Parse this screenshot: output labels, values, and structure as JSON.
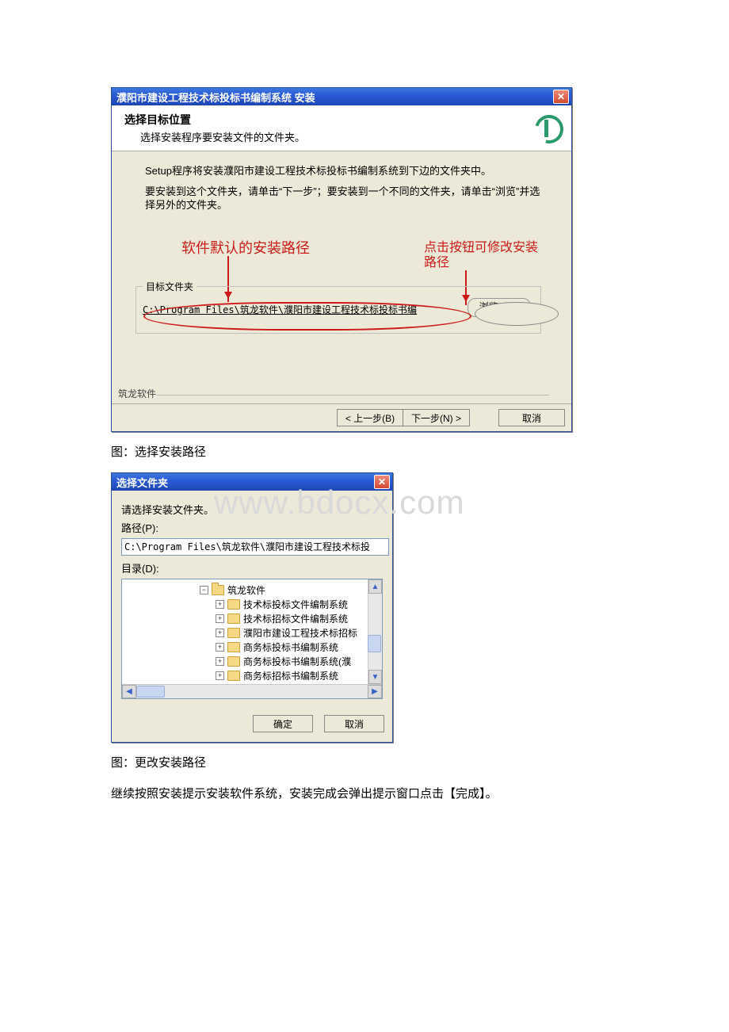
{
  "watermark": "www.bdocx.com",
  "win1": {
    "title": "濮阳市建设工程技术标投标书编制系统 安装",
    "header_bold": "选择目标位置",
    "header_sub": "选择安装程序要安装文件的文件夹。",
    "p1": "Setup程序将安装濮阳市建设工程技术标投标书编制系统到下边的文件夹中。",
    "p2": "要安装到这个文件夹，请单击“下一步”；要安装到一个不同的文件夹，请单击“浏览”并选择另外的文件夹。",
    "red_left": "软件默认的安装路径",
    "red_right": "点击按钮可修改安装路径",
    "fieldset_legend": "目标文件夹",
    "install_path": "C:\\Program Files\\筑龙软件\\濮阳市建设工程技术标投标书编",
    "browse_label": "浏览(R)...",
    "brand": "筑龙软件",
    "back_label": "< 上一步(B)",
    "next_label": "下一步(N) >",
    "cancel_label": "取消"
  },
  "caption1": "图：选择安装路径",
  "win2": {
    "title": "选择文件夹",
    "prompt": "请选择安装文件夹。",
    "path_label": "路径(P):",
    "path_value": "C:\\Program Files\\筑龙软件\\濮阳市建设工程技术标投",
    "dir_label": "目录(D):",
    "tree": {
      "root": "筑龙软件",
      "children": [
        "技术标投标文件编制系统",
        "技术标招标文件编制系统",
        "濮阳市建设工程技术标招标",
        "商务标投标书编制系统",
        "商务标投标书编制系统(濮",
        "商务标招标书编制系统"
      ]
    },
    "ok_label": "确定",
    "cancel_label": "取消"
  },
  "caption2": "图：更改安装路径",
  "para_final": "继续按照安装提示安装软件系统，安装完成会弹出提示窗口点击【完成】。"
}
